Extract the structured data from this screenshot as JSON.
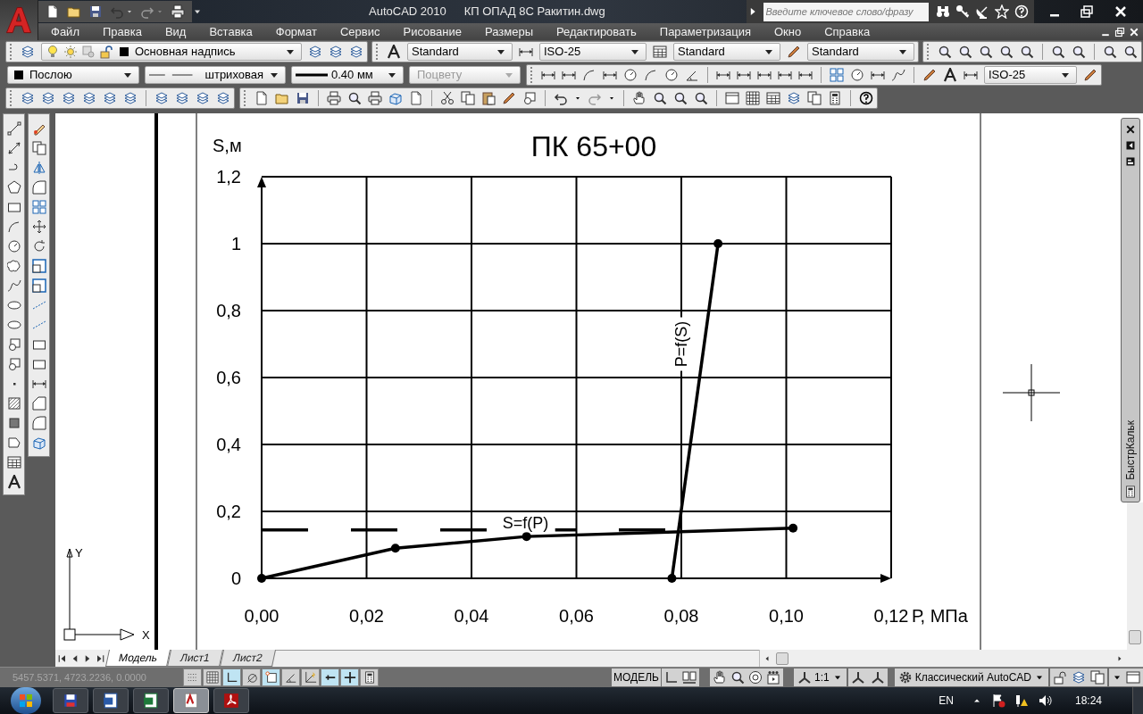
{
  "title_bar": {
    "app_name": "AutoCAD 2010",
    "document": "КП ОПАД 8С Ракитин.dwg",
    "search": {
      "placeholder": "Введите ключевое слово/фразу"
    }
  },
  "menu": [
    "Файл",
    "Правка",
    "Вид",
    "Вставка",
    "Формат",
    "Сервис",
    "Рисование",
    "Размеры",
    "Редактировать",
    "Параметризация",
    "Окно",
    "Справка"
  ],
  "toolbars": {
    "layer": "Основная надпись",
    "text_style": "Standard",
    "dim_style": "ISO-25",
    "table_style": "Standard",
    "mleader_style": "Standard",
    "color_control": "Послою",
    "linetype": "штриховая",
    "lineweight": "0.40 мм",
    "plot_style": {
      "value": "Поцвету",
      "disabled": true
    },
    "dim_style_2": "ISO-25"
  },
  "drawing": {
    "chart_data": {
      "type": "line",
      "title": "ПК 65+00",
      "xlabel": "Р, МПа",
      "ylabel": "S,м",
      "xlim": [
        0,
        0.12
      ],
      "ylim": [
        0,
        1.2
      ],
      "xticks": [
        {
          "value": 0,
          "label": "0,00"
        },
        {
          "value": 0.02,
          "label": "0,02"
        },
        {
          "value": 0.04,
          "label": "0,04"
        },
        {
          "value": 0.06,
          "label": "0,06"
        },
        {
          "value": 0.08,
          "label": "0,08"
        },
        {
          "value": 0.1,
          "label": "0,10"
        },
        {
          "value": 0.12,
          "label": "0,12"
        }
      ],
      "yticks": [
        {
          "value": 0,
          "label": "0"
        },
        {
          "value": 0.2,
          "label": "0,2"
        },
        {
          "value": 0.4,
          "label": "0,4"
        },
        {
          "value": 0.6,
          "label": "0,6"
        },
        {
          "value": 0.8,
          "label": "0,8"
        },
        {
          "value": 1,
          "label": "1"
        },
        {
          "value": 1.2,
          "label": "1,2"
        }
      ],
      "series": [
        {
          "color": "#000000",
          "marker": true,
          "x": [
            0,
            0.0255,
            0.0505,
            0.1013
          ],
          "values": [
            0,
            0.09,
            0.125,
            0.15
          ]
        },
        {
          "color": "#000000",
          "marker": true,
          "x": [
            0.0782,
            0.087
          ],
          "values": [
            0,
            1.0
          ]
        },
        {
          "color": "#000000",
          "marker": false,
          "line_style": "dashed",
          "x": [
            0,
            0.079
          ],
          "values": [
            0.145,
            0.145
          ]
        }
      ],
      "grid": true,
      "annotations": [
        "S=f(P)",
        "P=f(S)"
      ]
    },
    "ucs": {
      "x_label": "X",
      "y_label": "Y"
    }
  },
  "layout_tabs": [
    {
      "label": "Модель",
      "selected": true
    },
    {
      "label": "Лист1",
      "selected": false
    },
    {
      "label": "Лист2",
      "selected": false
    }
  ],
  "palette": {
    "title": "БыстрКальк"
  },
  "status_bar": {
    "coordinates": "5457.5371, 4723.2236, 0.0000",
    "toggles": [
      {
        "on": false
      },
      {
        "on": false
      },
      {
        "on": true
      },
      {
        "on": false
      },
      {
        "on": true
      },
      {
        "on": false
      },
      {
        "on": false
      },
      {
        "on": true
      },
      {
        "on": true
      },
      {
        "on": false
      }
    ],
    "space": "МОДЕЛЬ",
    "scale": "1:1",
    "workspace": "Классический AutoCAD"
  },
  "taskbar": {
    "apps": [
      {
        "kind": "disk",
        "selected": false
      },
      {
        "kind": "doc",
        "selected": false
      },
      {
        "kind": "sheet",
        "selected": false
      },
      {
        "kind": "cad",
        "selected": true
      },
      {
        "kind": "pdf",
        "selected": false
      }
    ],
    "language": "EN",
    "time": "18:24"
  }
}
